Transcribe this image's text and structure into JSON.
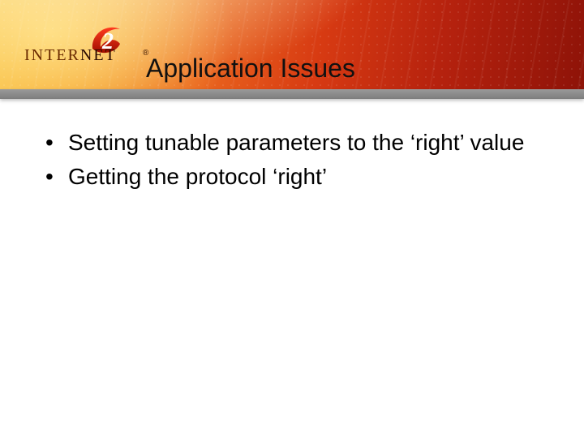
{
  "logo": {
    "segment1": "INTER",
    "segment2": "NET",
    "numeral": "2",
    "registered": "®"
  },
  "title": "Application Issues",
  "bullets": [
    "Setting tunable parameters to the ‘right’ value",
    "Getting the protocol ‘right’"
  ]
}
